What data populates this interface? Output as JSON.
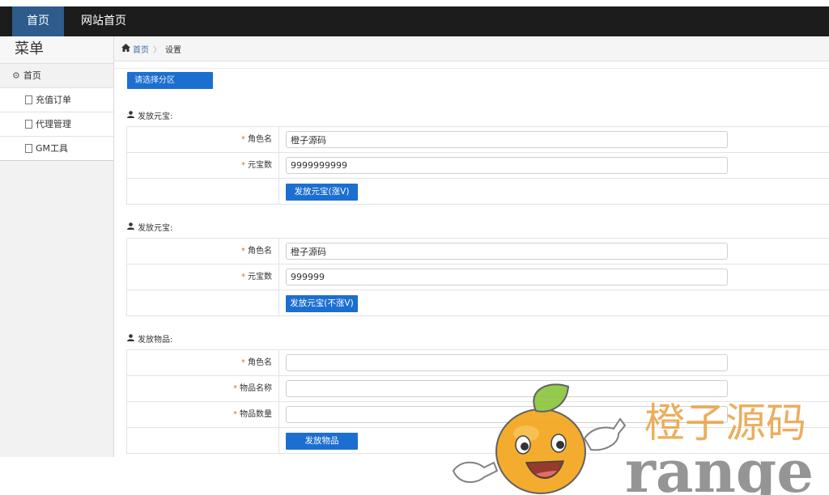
{
  "topnav": {
    "home": "首页",
    "site_home": "网站首页"
  },
  "sidebar": {
    "title": "菜单",
    "items": [
      {
        "label": "首页",
        "icon": "gear-icon"
      },
      {
        "label": "充值订单",
        "icon": "page-icon"
      },
      {
        "label": "代理管理",
        "icon": "page-icon"
      },
      {
        "label": "GM工具",
        "icon": "page-icon"
      }
    ]
  },
  "breadcrumb": {
    "home": "首页",
    "current": "设置"
  },
  "area_button": "请选择分区",
  "sections": [
    {
      "title": "发放元宝:",
      "fields": [
        {
          "label": "角色名",
          "value": "橙子源码"
        },
        {
          "label": "元宝数",
          "value": "9999999999"
        }
      ],
      "button": "发放元宝(涨V)"
    },
    {
      "title": "发放元宝:",
      "fields": [
        {
          "label": "角色名",
          "value": "橙子源码"
        },
        {
          "label": "元宝数",
          "value": "999999"
        }
      ],
      "button": "发放元宝(不涨V)"
    },
    {
      "title": "发放物品:",
      "fields": [
        {
          "label": "角色名",
          "value": ""
        },
        {
          "label": "物品名称",
          "value": ""
        },
        {
          "label": "物品数量",
          "value": ""
        }
      ],
      "button": "发放物品"
    }
  ],
  "required_mark": "*",
  "watermark": {
    "text_cn": "橙子源码",
    "text_en": "range"
  },
  "colors": {
    "topbar": "#1c1c1c",
    "active_nav": "#2c5b8c",
    "button": "#1c6fd0",
    "required": "#e07020"
  }
}
